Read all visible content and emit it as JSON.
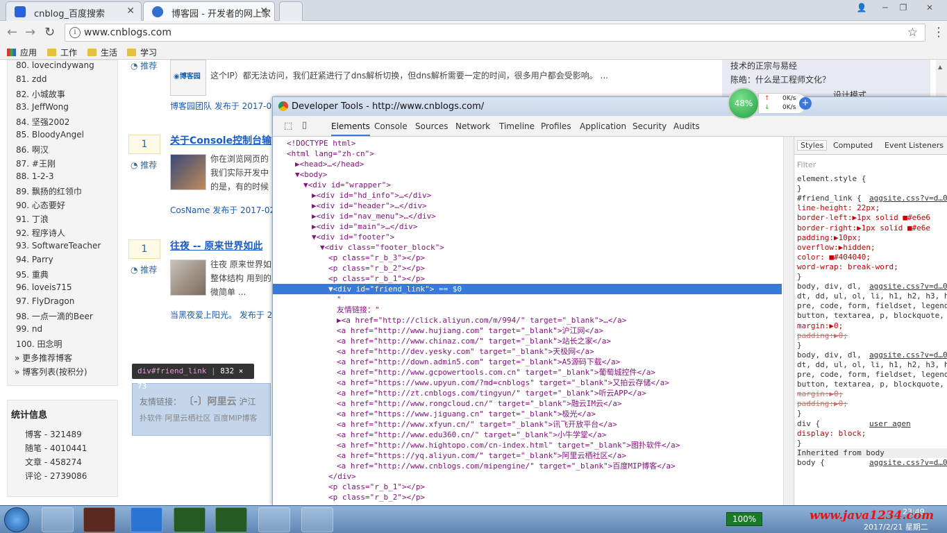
{
  "browser": {
    "tabs": [
      {
        "title": "cnblog_百度搜索",
        "active": false
      },
      {
        "title": "博客园 - 开发者的网上家",
        "active": true
      }
    ],
    "url": "www.cnblogs.com",
    "bookmarks": [
      "应用",
      "工作",
      "生活",
      "学习"
    ]
  },
  "sidebar": {
    "ranking": [
      "80. lovecindywang",
      "81. zdd",
      "82. 小城故事",
      "83. JeffWong",
      "84. 坚强2002",
      "85. BloodyAngel",
      "86. 啊汉",
      "87. #王刚",
      "88. 1-2-3",
      "89. 飘扬的红领巾",
      "90. 心态要好",
      "91. 丁浪",
      "92. 程序诗人",
      "93. SoftwareTeacher",
      "94. Parry",
      "95. 重典",
      "96. loveis715",
      "97. FlyDragon",
      "98. 一点一滴的Beer",
      "99. nd",
      "100. 田念明"
    ],
    "more_links": [
      "» 更多推荐博客",
      "» 博客列表(按积分)"
    ],
    "stats_title": "统计信息",
    "stats": [
      "博客 - 321489",
      "随笔 - 4010441",
      "文章 - 458274",
      "评论 - 2739086"
    ]
  },
  "posts": [
    {
      "snippet_top": "这个IP）都无法访问，我们赶紧进行了dns解析切换，但dns解析需要一定的时间，很多用户都会受影响。 ...",
      "meta": "博客园团队 发布于 2017-02",
      "vote": "",
      "recommend": "推荐"
    },
    {
      "vote": "1",
      "recommend": "推荐",
      "title": "关于Console控制台输",
      "lines": [
        "你在浏览网页的",
        "我们实际开发中",
        "的是，有的时候"
      ],
      "meta": "CosName 发布于 2017-02"
    },
    {
      "vote": "1",
      "recommend": "推荐",
      "title": "往夜 -- 原来世界如此",
      "lines": [
        "往夜 原来世界如",
        "整体结构 用到的",
        "微简单 ..."
      ],
      "meta": "当黑夜爱上阳光。 发布于 2"
    }
  ],
  "right_column": [
    "技术的正宗与易经",
    "陈皓：什么是工程师文化？",
    "设计模式"
  ],
  "friend_link_preview": {
    "label": "友情链接：",
    "logo": "阿里云",
    "rest": "沪江",
    "line2": "扑软件  阿里云栖社区  百度MIP博客"
  },
  "tooltip": {
    "selector": "div#friend_link",
    "size": "832 × 73"
  },
  "devtools": {
    "title": "Developer Tools - http://www.cnblogs.com/",
    "tabs": [
      "Elements",
      "Console",
      "Sources",
      "Network",
      "Timeline",
      "Profiles",
      "Application",
      "Security",
      "Audits"
    ],
    "styles_tabs": [
      "Styles",
      "Computed",
      "Event Listeners"
    ],
    "filter_placeholder": "Filter",
    "dom_lines": [
      {
        "indent": 0,
        "html": "<!DOCTYPE html>"
      },
      {
        "indent": 0,
        "html": "<html lang=\"zh-cn\">"
      },
      {
        "indent": 1,
        "html": "▶<head>…</head>"
      },
      {
        "indent": 1,
        "html": "▼<body>"
      },
      {
        "indent": 2,
        "html": "▼<div id=\"wrapper\">"
      },
      {
        "indent": 3,
        "html": "▶<div id=\"hd_info\">…</div>"
      },
      {
        "indent": 3,
        "html": "▶<div id=\"header\">…</div>"
      },
      {
        "indent": 3,
        "html": "▶<div id=\"nav_menu\">…</div>"
      },
      {
        "indent": 3,
        "html": "▶<div id=\"main\">…</div>"
      },
      {
        "indent": 3,
        "html": "▼<div id=\"footer\">"
      },
      {
        "indent": 4,
        "html": "▼<div class=\"footer_block\">"
      },
      {
        "indent": 5,
        "html": "<p class=\"r_b_3\"></p>"
      },
      {
        "indent": 5,
        "html": "<p class=\"r_b_2\"></p>"
      },
      {
        "indent": 5,
        "html": "<p class=\"r_b_1\"></p>"
      },
      {
        "indent": 5,
        "html": "▼<div id=\"friend_link\"> == $0",
        "selected": true
      },
      {
        "indent": 6,
        "html": "\""
      },
      {
        "indent": 6,
        "html": "友情链接：\""
      },
      {
        "indent": 6,
        "html": "▶<a href=\"http://click.aliyun.com/m/994/\" target=\"_blank\">…</a>"
      },
      {
        "indent": 6,
        "html": "<a href=\"http://www.hujiang.com\" target=\"_blank\">沪江网</a>"
      },
      {
        "indent": 6,
        "html": "<a href=\"http://www.chinaz.com/\" target=\"_blank\">站长之家</a>"
      },
      {
        "indent": 6,
        "html": "<a href=\"http://dev.yesky.com\" target=\"_blank\">天极网</a>"
      },
      {
        "indent": 6,
        "html": "<a href=\"http://down.admin5.com\" target=\"_blank\">A5源码下载</a>"
      },
      {
        "indent": 6,
        "html": "<a href=\"http://www.gcpowertools.com.cn\" target=\"_blank\">葡萄城控件</a>"
      },
      {
        "indent": 6,
        "html": "<a href=\"https://www.upyun.com/?md=cnblogs\" target=\"_blank\">又拍云存储</a>"
      },
      {
        "indent": 6,
        "html": "<a href=\"http://zt.cnblogs.com/tingyun/\" target=\"_blank\">听云APP</a>"
      },
      {
        "indent": 6,
        "html": "<a href=\"http://www.rongcloud.cn/\" target=\"_blank\">融云IM云</a>"
      },
      {
        "indent": 6,
        "html": "<a href=\"https://www.jiguang.cn\" target=\"_blank\">极光</a>"
      },
      {
        "indent": 6,
        "html": "<a href=\"http://www.xfyun.cn/\" target=\"_blank\">讯飞开放平台</a>"
      },
      {
        "indent": 6,
        "html": "<a href=\"http://www.edu360.cn/\" target=\"_blank\">小牛学堂</a>"
      },
      {
        "indent": 6,
        "html": "<a href=\"http://www.hightopo.com/cn-index.html\" target=\"_blank\">图扑软件</a>"
      },
      {
        "indent": 6,
        "html": "<a href=\"https://yq.aliyun.com/\" target=\"_blank\">阿里云栖社区</a>"
      },
      {
        "indent": 6,
        "html": "<a href=\"http://www.cnblogs.com/mipengine/\" target=\"_blank\">百度MIP博客</a>"
      },
      {
        "indent": 5,
        "html": "</div>"
      },
      {
        "indent": 5,
        "html": "<p class=\"r_b_1\"></p>"
      },
      {
        "indent": 5,
        "html": "<p class=\"r_b_2\"></p>"
      }
    ],
    "styles": [
      {
        "t": "element.style {",
        "k": "sel"
      },
      {
        "t": "}",
        "k": "sel"
      },
      {
        "t": "#friend_link {",
        "k": "sel",
        "src": "aggsite.css?v=d…0"
      },
      {
        "t": "  line-height: 22px;",
        "k": "prop"
      },
      {
        "t": "  border-left:▶1px solid ■#e6e6",
        "k": "prop"
      },
      {
        "t": "  border-right:▶1px solid ■#e6e",
        "k": "prop"
      },
      {
        "t": "  padding:▶10px;",
        "k": "prop"
      },
      {
        "t": "  overflow:▶hidden;",
        "k": "prop"
      },
      {
        "t": "  color: ■#404040;",
        "k": "prop"
      },
      {
        "t": "  word-wrap: break-word;",
        "k": "prop"
      },
      {
        "t": "}",
        "k": "sel"
      },
      {
        "t": "body, div, dl,",
        "k": "sel",
        "src": "aggsite.css?v=d…0"
      },
      {
        "t": "dt, dd, ul, ol, li, h1, h2, h3, h",
        "k": "sel"
      },
      {
        "t": "pre, code, form, fieldset, legend",
        "k": "sel"
      },
      {
        "t": "button, textarea, p, blockquote,",
        "k": "sel"
      },
      {
        "t": "  margin:▶0;",
        "k": "prop"
      },
      {
        "t": "  padding:▶0;",
        "k": "strike"
      },
      {
        "t": "}",
        "k": "sel"
      },
      {
        "t": "body, div, dl,",
        "k": "sel",
        "src": "aggsite.css?v=d…0"
      },
      {
        "t": "dt, dd, ul, ol, li, h1, h2, h3, h",
        "k": "sel"
      },
      {
        "t": "pre, code, form, fieldset, legend",
        "k": "sel"
      },
      {
        "t": "button, textarea, p, blockquote,",
        "k": "sel"
      },
      {
        "t": "  margin:▶0;",
        "k": "strike"
      },
      {
        "t": "  padding:▶0;",
        "k": "strike"
      },
      {
        "t": "}",
        "k": "sel"
      },
      {
        "t": "div {",
        "k": "sel",
        "src": "user agen"
      },
      {
        "t": "  display: block;",
        "k": "prop"
      },
      {
        "t": "}",
        "k": "sel"
      },
      {
        "t": "Inherited from body",
        "k": "inh"
      },
      {
        "t": "body {",
        "k": "sel",
        "src": "aggsite.css?v=d…0"
      }
    ]
  },
  "net_widget": {
    "percent": "48%",
    "up": "0K/s",
    "down": "0K/s"
  },
  "taskbar": {
    "battery": "100%",
    "time": "23:49",
    "date": "2017/2/21 星期二",
    "watermark": "www.java1234.com"
  }
}
